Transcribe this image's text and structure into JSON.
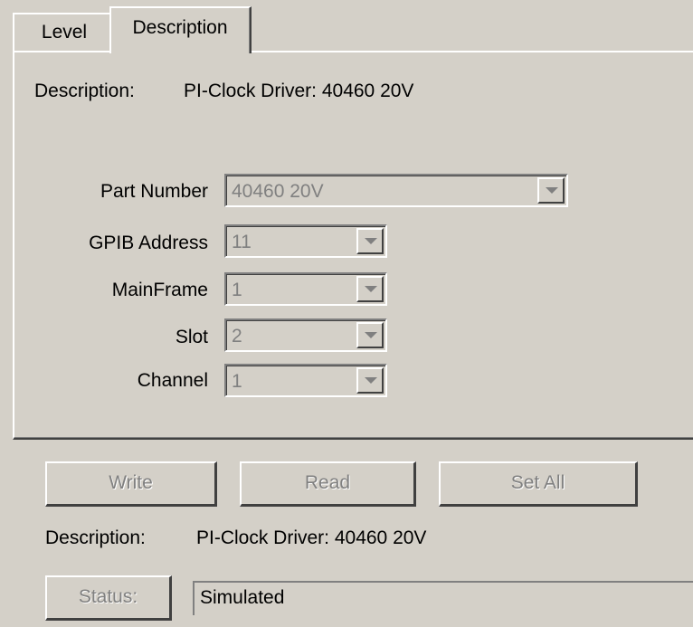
{
  "tabs": [
    {
      "label": "Level"
    },
    {
      "label": "Description"
    }
  ],
  "panel": {
    "description_label": "Description:",
    "description_value": "PI-Clock Driver: 40460 20V",
    "fields": {
      "part_number": {
        "label": "Part Number",
        "value": "40460 20V"
      },
      "gpib_address": {
        "label": "GPIB Address",
        "value": "11"
      },
      "mainframe": {
        "label": "MainFrame",
        "value": "1"
      },
      "slot": {
        "label": "Slot",
        "value": "2"
      },
      "channel": {
        "label": "Channel",
        "value": "1"
      }
    }
  },
  "buttons": {
    "write": "Write",
    "read": "Read",
    "set_all": "Set All",
    "status": "Status:"
  },
  "footer": {
    "description_label": "Description:",
    "description_value": "PI-Clock Driver: 40460 20V",
    "status_value": "Simulated"
  },
  "colors": {
    "face": "#d4d0c8",
    "disabled_text": "#808080"
  }
}
